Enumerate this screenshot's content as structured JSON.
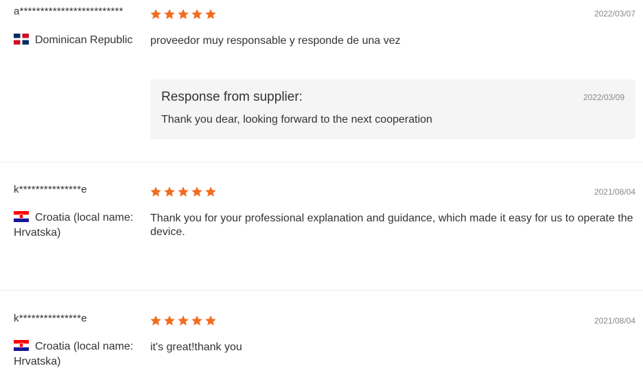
{
  "theme": {
    "star_color": "#f26c20",
    "flag_dr_blue": "#002d62",
    "flag_dr_red": "#ce1126",
    "flag_hr_red": "#ff0000",
    "flag_hr_blue": "#171796"
  },
  "reviews": [
    {
      "name": "a*************************",
      "rating": 5,
      "date": "2022/03/07",
      "flag_icon": "dominican-republic-flag",
      "country": "Dominican Republic",
      "comment": "proveedor muy responsable y responde de una vez",
      "response": {
        "title": "Response from supplier:",
        "date": "2022/03/09",
        "text": "Thank you dear, looking forward to the next cooperation"
      }
    },
    {
      "name": "k***************e",
      "rating": 5,
      "date": "2021/08/04",
      "flag_icon": "croatia-flag",
      "country": "Croatia (local name: Hrvatska)",
      "comment": "Thank you for your professional explanation and guidance, which made it easy for us to operate the device."
    },
    {
      "name": "k***************e",
      "rating": 5,
      "date": "2021/08/04",
      "flag_icon": "croatia-flag",
      "country": "Croatia (local name: Hrvatska)",
      "comment": "it's great!thank you"
    }
  ]
}
